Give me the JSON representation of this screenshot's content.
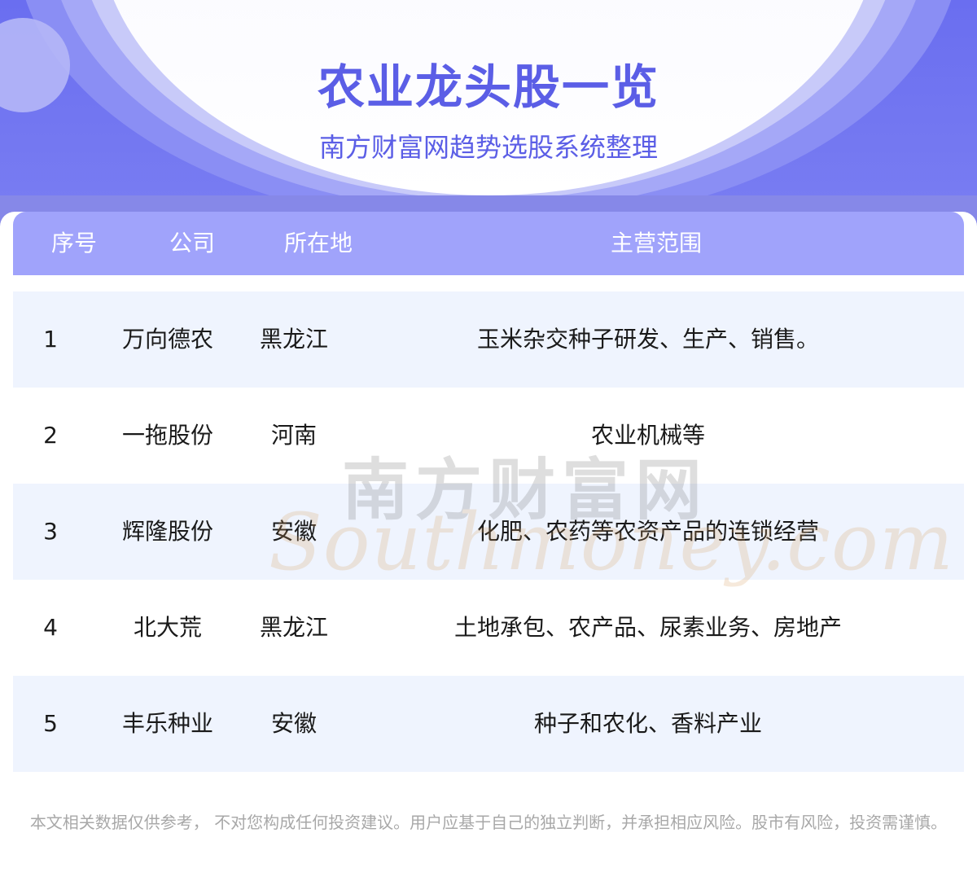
{
  "header": {
    "title": "农业龙头股一览",
    "subtitle": "南方财富网趋势选股系统整理"
  },
  "table": {
    "columns": [
      "序号",
      "公司",
      "所在地",
      "主营范围"
    ],
    "rows": [
      {
        "seq": "1",
        "company": "万向德农",
        "location": "黑龙江",
        "scope": "玉米杂交种子研发、生产、销售。"
      },
      {
        "seq": "2",
        "company": "一拖股份",
        "location": "河南",
        "scope": "农业机械等"
      },
      {
        "seq": "3",
        "company": "辉隆股份",
        "location": "安徽",
        "scope": "化肥、农药等农资产品的连锁经营"
      },
      {
        "seq": "4",
        "company": "北大荒",
        "location": "黑龙江",
        "scope": "土地承包、农产品、尿素业务、房地产"
      },
      {
        "seq": "5",
        "company": "丰乐种业",
        "location": "安徽",
        "scope": "种子和农化、香料产业"
      }
    ]
  },
  "watermark": {
    "cn": "南方财富网",
    "en": "Southmoney.com"
  },
  "footer": {
    "disclaimer": "本文相关数据仅供参考， 不对您构成任何投资建议。用户应基于自己的独立判断，并承担相应风险。股市有风险，投资需谨慎。"
  },
  "colors": {
    "accent": "#5b5ee6",
    "header_bg": "#a0a3fb",
    "row_shade": "#eff4fe"
  }
}
